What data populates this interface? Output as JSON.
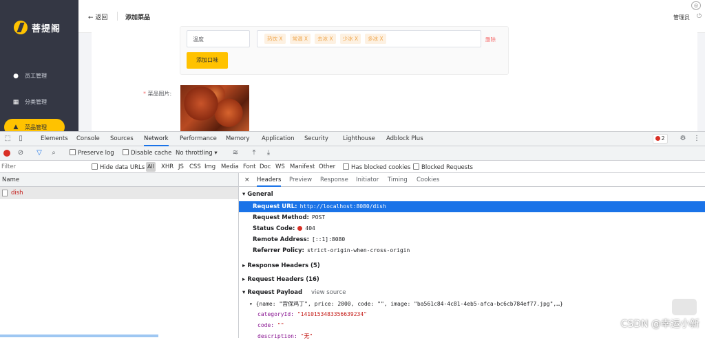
{
  "app": {
    "logo": "菩提阁",
    "sidebar": {
      "items": [
        {
          "label": "员工管理"
        },
        {
          "label": "分类管理"
        },
        {
          "label": "菜品管理"
        }
      ]
    },
    "topbar": {
      "back": "← 返回",
      "title": "添加菜品",
      "user": "管理员"
    },
    "flavor": {
      "name": "温度",
      "tags": [
        "热饮 X",
        "常温 X",
        "去冰 X",
        "少冰 X",
        "多冰 X"
      ],
      "delete": "删除",
      "add_button": "添加口味"
    },
    "image_label": "菜品图片:"
  },
  "devtools": {
    "tabs": [
      "Elements",
      "Console",
      "Sources",
      "Network",
      "Performance",
      "Memory",
      "Application",
      "Security",
      "Lighthouse",
      "Adblock Plus"
    ],
    "error_count": "2",
    "toolbar": {
      "preserve_log": "Preserve log",
      "disable_cache": "Disable cache",
      "throttle": "No throttling"
    },
    "filter": {
      "placeholder": "Filter",
      "hide_data": "Hide data URLs",
      "all": "All",
      "types": [
        "XHR",
        "JS",
        "CSS",
        "Img",
        "Media",
        "Font",
        "Doc",
        "WS",
        "Manifest",
        "Other"
      ],
      "blocked_cookies": "Has blocked cookies",
      "blocked_requests": "Blocked Requests"
    },
    "name_header": "Name",
    "request": "dish",
    "detail_tabs": [
      "Headers",
      "Preview",
      "Response",
      "Initiator",
      "Timing",
      "Cookies"
    ],
    "general": {
      "title": "General",
      "url_key": "Request URL:",
      "url": "http://localhost:8080/dish",
      "method_key": "Request Method:",
      "method": "POST",
      "status_key": "Status Code:",
      "status": "404",
      "addr_key": "Remote Address:",
      "addr": "[::1]:8080",
      "policy_key": "Referrer Policy:",
      "policy": "strict-origin-when-cross-origin"
    },
    "response_headers": "Response Headers (5)",
    "request_headers": "Request Headers (16)",
    "payload_title": "Request Payload",
    "view_source": "view source",
    "payload": {
      "summary": "{name: \"宫保鸡丁\", price: 2000, code: \"\", image: \"ba561c84-4c81-4eb5-afca-bc6cb784ef77.jpg\",…}",
      "category_key": "categoryId:",
      "category": "\"1410153483356639234\"",
      "code_key": "code:",
      "code": "\"\"",
      "desc_key": "description:",
      "desc": "\"无\""
    }
  },
  "watermark": "CSDN @幸运小新"
}
